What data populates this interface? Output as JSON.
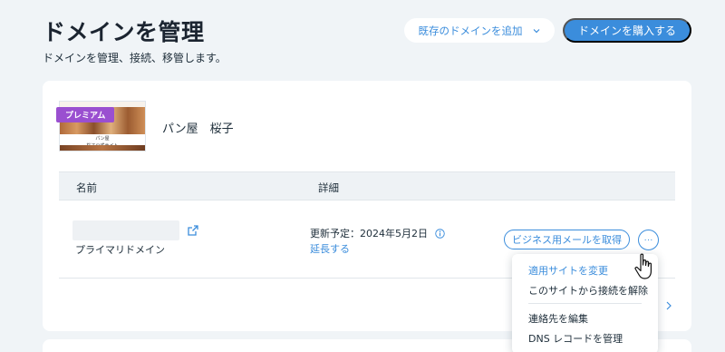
{
  "header": {
    "title": "ドメインを管理",
    "subtitle": "ドメインを管理、接続、移管します。",
    "add_existing_label": "既存のドメインを追加",
    "buy_label": "ドメインを購入する"
  },
  "site": {
    "badge": "プレミアム",
    "name": "パン屋　桜子",
    "thumb_line1": "パン屋",
    "thumb_line2": "桜子公式サイト"
  },
  "table": {
    "columns": [
      "名前",
      "詳細"
    ]
  },
  "domain_row": {
    "type_label": "プライマリドメイン",
    "renewal_text": "更新予定：2024年5月2日",
    "extend_label": "延長する",
    "email_button_label": "ビジネス用メールを取得",
    "more_button_label": "···"
  },
  "menu": {
    "items": [
      "適用サイトを変更",
      "このサイトから接続を解除",
      "連絡先を編集",
      "DNS レコードを管理"
    ]
  },
  "colors": {
    "accent": "#3b8ddc",
    "badge": "#9a4fd0",
    "background": "#f0f4f7"
  }
}
